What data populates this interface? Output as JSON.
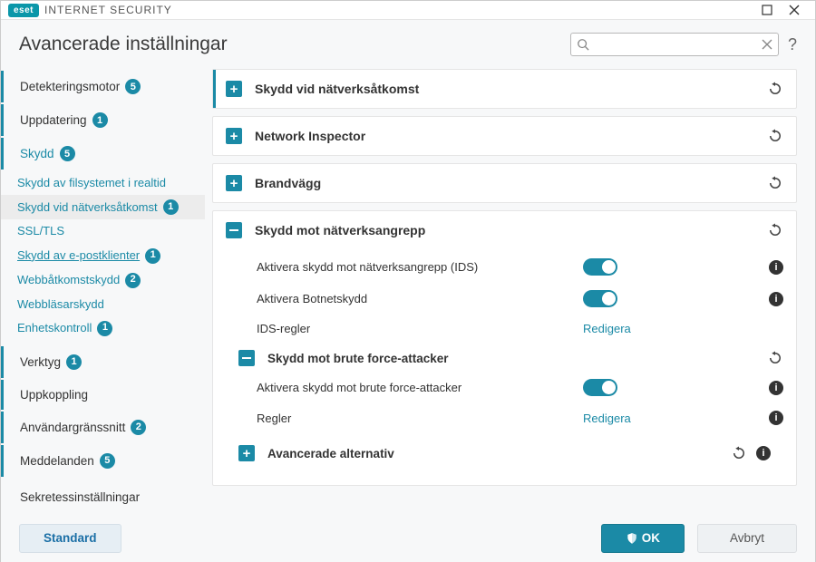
{
  "brand": {
    "badge": "eset",
    "product": "INTERNET SECURITY"
  },
  "header": {
    "title": "Avancerade inställningar"
  },
  "sidebar": {
    "items": [
      {
        "label": "Detekteringsmotor",
        "badge": "5"
      },
      {
        "label": "Uppdatering",
        "badge": "1"
      },
      {
        "label": "Skydd",
        "badge": "5"
      }
    ],
    "subs": [
      {
        "label": "Skydd av filsystemet i realtid"
      },
      {
        "label": "Skydd vid nätverksåtkomst",
        "badge": "1"
      },
      {
        "label": "SSL/TLS"
      },
      {
        "label": "Skydd av e-postklienter",
        "badge": "1"
      },
      {
        "label": "Webbåtkomstskydd",
        "badge": "2"
      },
      {
        "label": "Webbläsarskydd"
      },
      {
        "label": "Enhetskontroll",
        "badge": "1"
      }
    ],
    "tail": [
      {
        "label": "Verktyg",
        "badge": "1"
      },
      {
        "label": "Uppkoppling"
      },
      {
        "label": "Användargränssnitt",
        "badge": "2"
      },
      {
        "label": "Meddelanden",
        "badge": "5"
      },
      {
        "label": "Sekretessinställningar"
      }
    ]
  },
  "panels": {
    "p0": "Skydd vid nätverksåtkomst",
    "p1": "Network Inspector",
    "p2": "Brandvägg",
    "p3": {
      "title": "Skydd mot nätverksangrepp",
      "r0": "Aktivera skydd mot nätverksangrepp (IDS)",
      "r1": "Aktivera Botnetskydd",
      "r2": "IDS-regler",
      "edit": "Redigera",
      "sub": {
        "title": "Skydd mot brute force-attacker",
        "r0": "Aktivera skydd mot brute force-attacker",
        "r1": "Regler",
        "edit": "Redigera"
      }
    },
    "p4": "Avancerade alternativ"
  },
  "footer": {
    "default": "Standard",
    "ok": "OK",
    "cancel": "Avbryt"
  }
}
